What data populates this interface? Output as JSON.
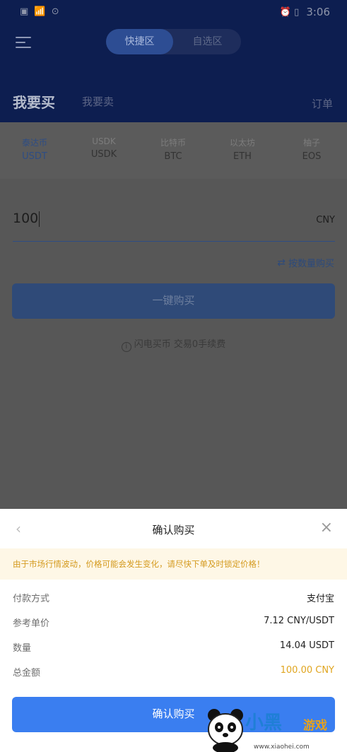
{
  "status_bar": {
    "left": "▣ 📶 ⊙",
    "icons": "⏰ ▯",
    "time": "3:06"
  },
  "header": {
    "segments": [
      "快捷区",
      "自选区"
    ],
    "buy_tab": "我要买",
    "sell_tab": "我要卖",
    "orders": "订单"
  },
  "coins": [
    {
      "cn": "泰达币",
      "sym": "USDT"
    },
    {
      "cn": "USDK",
      "sym": "USDK"
    },
    {
      "cn": "比特币",
      "sym": "BTC"
    },
    {
      "cn": "以太坊",
      "sym": "ETH"
    },
    {
      "cn": "柚子",
      "sym": "EOS"
    }
  ],
  "amount": {
    "value": "100",
    "currency": "CNY"
  },
  "by_quantity": "按数量购买",
  "one_click_buy": "一键购买",
  "fee_note": "闪电买币 交易0手续费",
  "sheet": {
    "title": "确认购买",
    "warning": "由于市场行情波动，价格可能会发生变化，请尽快下单及时锁定价格！",
    "details": [
      {
        "label": "付款方式",
        "value": "支付宝"
      },
      {
        "label": "参考单价",
        "value": "7.12 CNY/USDT"
      },
      {
        "label": "数量",
        "value": "14.04 USDT"
      },
      {
        "label": "总金额",
        "value": "100.00 CNY"
      }
    ],
    "confirm": "确认购买"
  },
  "watermark": {
    "text": "小黑",
    "game": "游戏",
    "url": "www.xiaohei.com"
  },
  "colors": {
    "accent": "#3a7ef0",
    "warning_text": "#d49a1e",
    "total": "#e0a51f"
  }
}
